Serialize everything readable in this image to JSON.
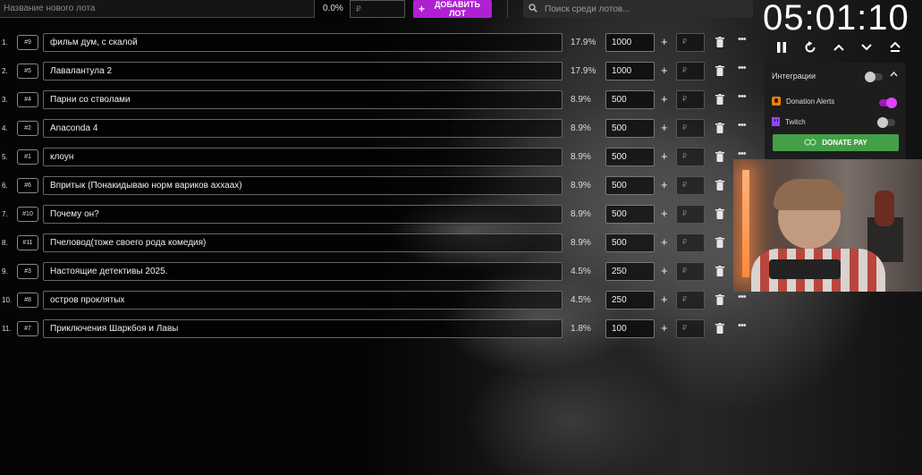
{
  "top_bar": {
    "name_placeholder": "Название нового лота",
    "percent": "0.0%",
    "amount_placeholder": "₽",
    "add_button_label": "ДОБАВИТЬ ЛОТ",
    "search_placeholder": "Поиск среди лотов..."
  },
  "lots": [
    {
      "index": "1.",
      "id": "#9",
      "title": "фильм дум, с скалой",
      "percent": "17.9%",
      "amount": "1000",
      "add_placeholder": "₽"
    },
    {
      "index": "2.",
      "id": "#5",
      "title": "Лавалантула 2",
      "percent": "17.9%",
      "amount": "1000",
      "add_placeholder": "₽"
    },
    {
      "index": "3.",
      "id": "#4",
      "title": "Парни со стволами",
      "percent": "8.9%",
      "amount": "500",
      "add_placeholder": "₽"
    },
    {
      "index": "4.",
      "id": "#2",
      "title": "Anaconda 4",
      "percent": "8.9%",
      "amount": "500",
      "add_placeholder": "₽"
    },
    {
      "index": "5.",
      "id": "#1",
      "title": "клоун",
      "percent": "8.9%",
      "amount": "500",
      "add_placeholder": "₽"
    },
    {
      "index": "6.",
      "id": "#6",
      "title": "Впритык (Понакидываю норм вариков аххаах)",
      "percent": "8.9%",
      "amount": "500",
      "add_placeholder": "₽"
    },
    {
      "index": "7.",
      "id": "#10",
      "title": "Почему он?",
      "percent": "8.9%",
      "amount": "500",
      "add_placeholder": "₽"
    },
    {
      "index": "8.",
      "id": "#11",
      "title": "Пчеловод(тоже своего рода комедия)",
      "percent": "8.9%",
      "amount": "500",
      "add_placeholder": "₽"
    },
    {
      "index": "9.",
      "id": "#3",
      "title": "Настоящие детективы 2025.",
      "percent": "4.5%",
      "amount": "250",
      "add_placeholder": "₽"
    },
    {
      "index": "10.",
      "id": "#8",
      "title": "остров проклятых",
      "percent": "4.5%",
      "amount": "250",
      "add_placeholder": "₽"
    },
    {
      "index": "11.",
      "id": "#7",
      "title": "Приключения Шаркбоя и Лавы",
      "percent": "1.8%",
      "amount": "100",
      "add_placeholder": "₽"
    }
  ],
  "timer": {
    "value": "05:01:10"
  },
  "integrations": {
    "title": "Интеграции",
    "donation_alerts_label": "Donation Alerts",
    "twitch_label": "Twitch",
    "donate_pay_label": "DONATE PAY",
    "donation_alerts_enabled": true,
    "twitch_enabled": false
  },
  "colors": {
    "accent": "#b11fd2",
    "donate_pay": "#43a047",
    "donation_alerts": "#f57d07",
    "twitch": "#9146ff"
  }
}
